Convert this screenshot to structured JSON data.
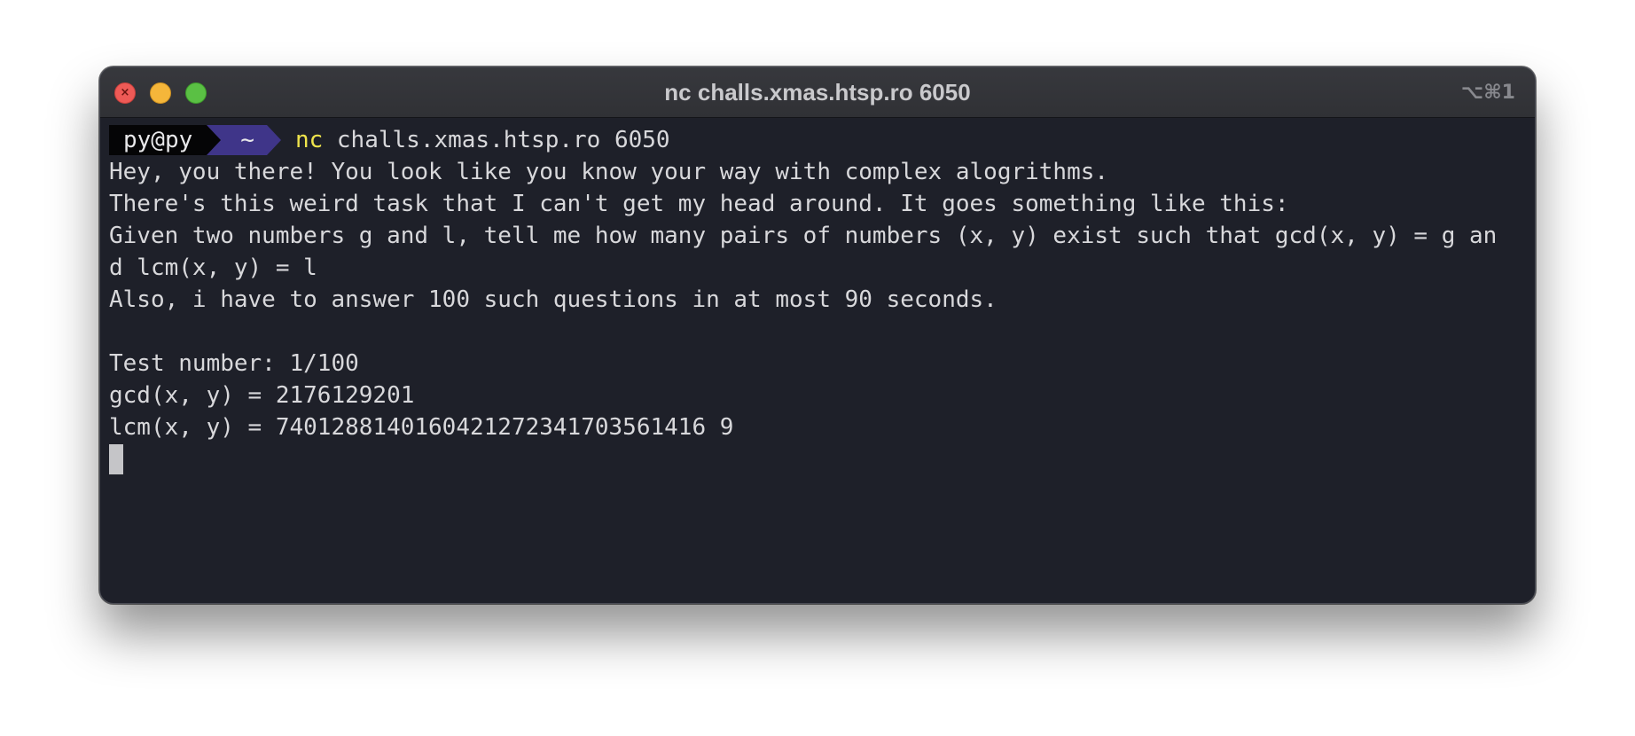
{
  "window": {
    "title": "nc challs.xmas.htsp.ro 6050",
    "shortcut": "⌥⌘1",
    "close_glyph": "×"
  },
  "prompt": {
    "user_host": "py@py",
    "directory": "~",
    "command": "nc",
    "arguments": " challs.xmas.htsp.ro 6050"
  },
  "output": {
    "lines": [
      "Hey, you there! You look like you know your way with complex alogrithms.",
      "There's this weird task that I can't get my head around. It goes something like this:",
      "Given two numbers g and l, tell me how many pairs of numbers (x, y) exist such that gcd(x, y) = g an",
      "d lcm(x, y) = l",
      "Also, i have to answer 100 such questions in at most 90 seconds.",
      "",
      "Test number: 1/100",
      "gcd(x, y) = 2176129201",
      "lcm(x, y) = 7401288140160421272341703561416 9"
    ]
  },
  "colors": {
    "terminal_bg": "#1e2029",
    "text": "#d8d8db",
    "command": "#efe44c",
    "prompt_user_bg": "#050506",
    "prompt_dir_bg": "#3f3589",
    "cursor": "#c5c5c8"
  }
}
